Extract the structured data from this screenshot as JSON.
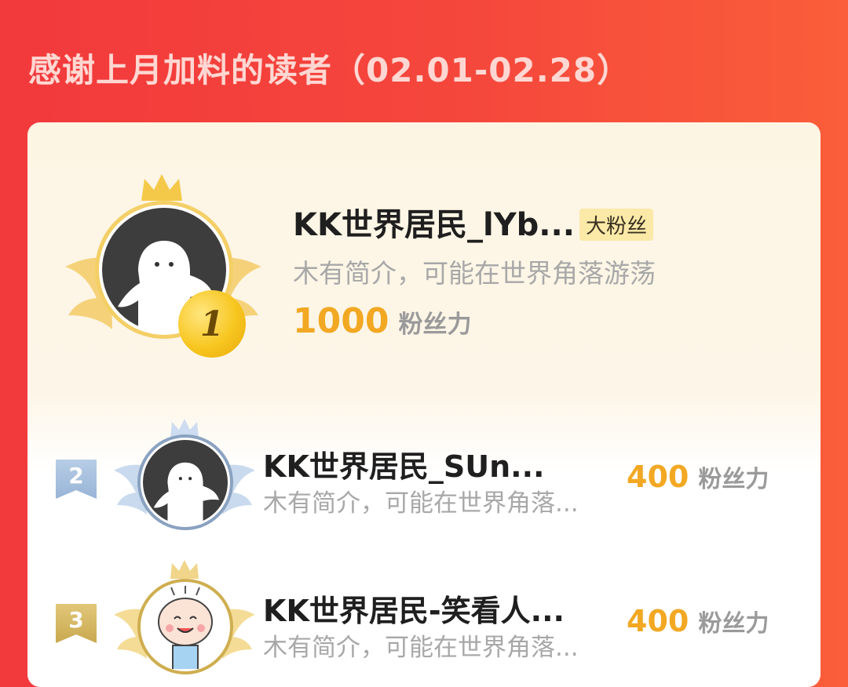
{
  "header": {
    "title": "感谢上月加料的读者（02.01-02.28）"
  },
  "colors": {
    "background": "#f2393c",
    "score": "#f2a823",
    "gold": "#f7c61f",
    "silver": "#a9c4e2",
    "bronze": "#d8b868"
  },
  "readers": [
    {
      "rank": "1",
      "name": "KK世界居民_lYb...",
      "badge": "大粉丝",
      "bio": "木有简介，可能在世界角落游荡",
      "score": "1000",
      "score_unit": "粉丝力",
      "avatar_icon": "default-ghost-avatar"
    },
    {
      "rank": "2",
      "name": "KK世界居民_SUn...",
      "bio": "木有简介，可能在世界角落...",
      "score": "400",
      "score_unit": "粉丝力",
      "avatar_icon": "default-ghost-avatar"
    },
    {
      "rank": "3",
      "name": "KK世界居民-笑看人...",
      "bio": "木有简介，可能在世界角落...",
      "score": "400",
      "score_unit": "粉丝力",
      "avatar_icon": "smiley-cartoon-avatar"
    }
  ]
}
